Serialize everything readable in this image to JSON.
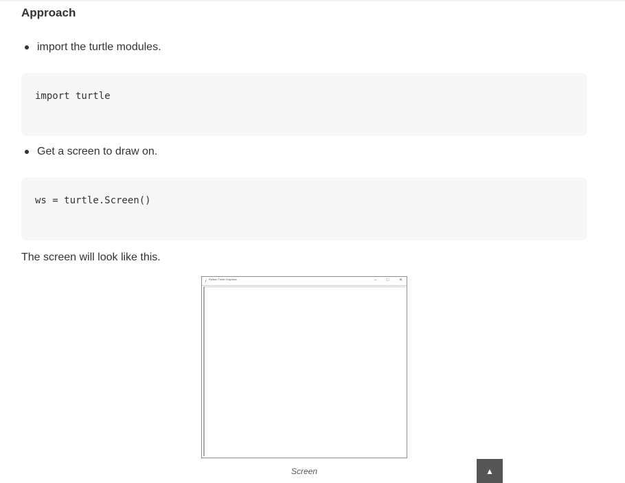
{
  "article": {
    "heading": "Approach",
    "steps": [
      {
        "text": "import the turtle modules.",
        "code": "import turtle"
      },
      {
        "text": "Get a screen to draw on.",
        "code": "ws = turtle.Screen()"
      }
    ],
    "paragraph": "The screen will look like this.",
    "figure": {
      "window_title": "Python Turtle Graphics",
      "minimize_glyph": "–",
      "maximize_glyph": "□",
      "close_glyph": "✕",
      "caption": "Screen"
    }
  },
  "scroll_top": {
    "icon": "up-triangle-icon",
    "glyph": "▲"
  }
}
